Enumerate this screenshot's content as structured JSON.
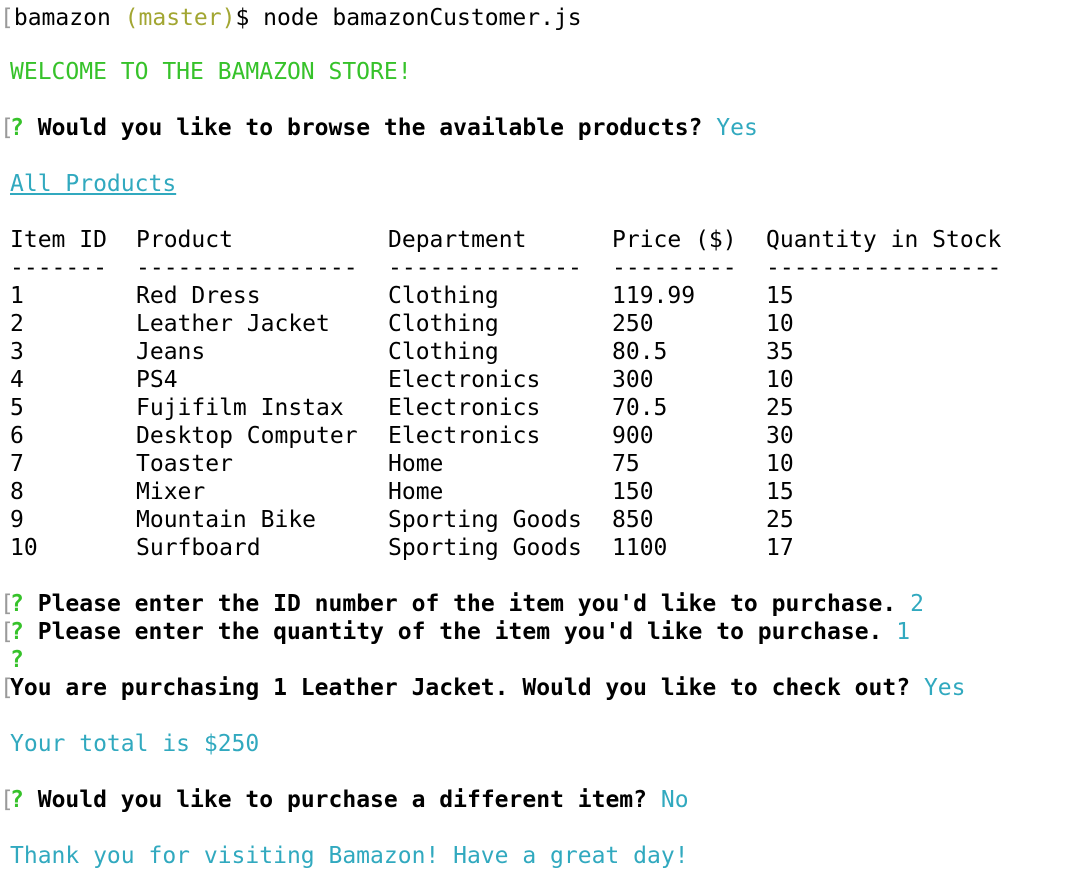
{
  "shell_prompt": {
    "bracket": "[",
    "dir": "bamazon",
    "branch": "(master)",
    "symbol": "$",
    "command": "node bamazonCustomer.js"
  },
  "welcome": "WELCOME TO THE BAMAZON STORE!",
  "q_browse": {
    "bracket": "[",
    "mark": "?",
    "question": "Would you like to browse the available products?",
    "answer": "Yes"
  },
  "all_products_label": "All Products",
  "table": {
    "headers": [
      "Item ID",
      "Product",
      "Department",
      "Price ($)",
      "Quantity in Stock"
    ],
    "dividers": [
      "-------",
      "----------------",
      "--------------",
      "---------",
      "-----------------"
    ],
    "rows": [
      [
        "1",
        "Red Dress",
        "Clothing",
        "119.99",
        "15"
      ],
      [
        "2",
        "Leather Jacket",
        "Clothing",
        "250",
        "10"
      ],
      [
        "3",
        "Jeans",
        "Clothing",
        "80.5",
        "35"
      ],
      [
        "4",
        "PS4",
        "Electronics",
        "300",
        "10"
      ],
      [
        "5",
        "Fujifilm Instax",
        "Electronics",
        "70.5",
        "25"
      ],
      [
        "6",
        "Desktop Computer",
        "Electronics",
        "900",
        "30"
      ],
      [
        "7",
        "Toaster",
        "Home",
        "75",
        "10"
      ],
      [
        "8",
        "Mixer",
        "Home",
        "150",
        "15"
      ],
      [
        "9",
        "Mountain Bike",
        "Sporting Goods",
        "850",
        "25"
      ],
      [
        "10",
        "Surfboard",
        "Sporting Goods",
        "1100",
        "17"
      ]
    ]
  },
  "q_id": {
    "bracket": "[",
    "mark": "?",
    "question": "Please enter the ID number of the item you'd like to purchase.",
    "answer": "2"
  },
  "q_qty": {
    "bracket": "[",
    "mark": "?",
    "question": "Please enter the quantity of the item you'd like to purchase.",
    "answer": "1"
  },
  "lone_mark": "?",
  "q_checkout": {
    "bracket": "[",
    "question": "You are purchasing 1 Leather Jacket. Would you like to check out?",
    "answer": "Yes"
  },
  "total_text": "Your total is $250",
  "q_different": {
    "bracket": "[",
    "mark": "?",
    "question": "Would you like to purchase a different item?",
    "answer": "No"
  },
  "farewell": "Thank you for visiting Bamazon! Have a great day!",
  "colors": {
    "green": "#36c22a",
    "cyan": "#31a9bf",
    "olive": "#a2a632",
    "bracket_gray": "#9a9a9a"
  }
}
